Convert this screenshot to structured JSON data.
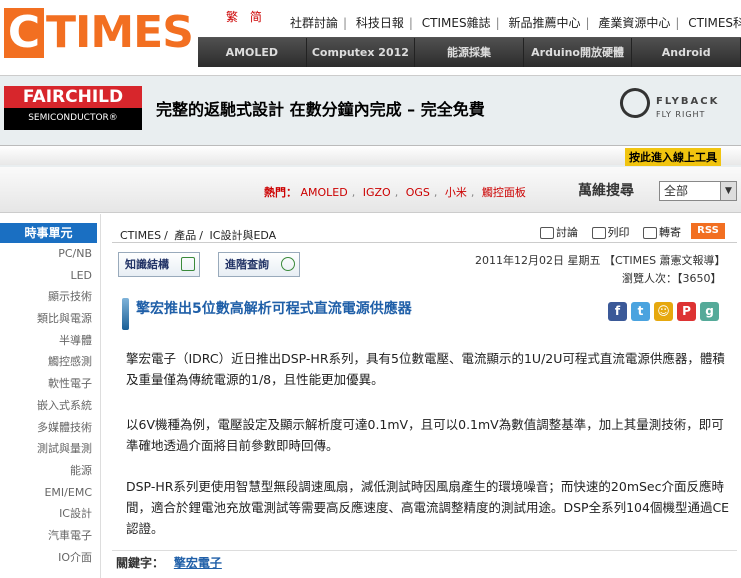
{
  "header": {
    "logo_c": "C",
    "logo_rest": "TIMES",
    "lang": [
      "繁",
      "简"
    ],
    "toplinks": [
      "社群討論",
      "科技日報",
      "CTIMES雜誌",
      "新品推薦中心",
      "產業資源中心",
      "CTIMES科技"
    ],
    "nav": [
      "AMOLED",
      "Computex 2012",
      "能源採集",
      "Arduino開放硬體",
      "Android"
    ]
  },
  "banner": {
    "fc_top": "FAIRCHILD",
    "fc_bottom": "SEMICONDUCTOR®",
    "text": "完整的返馳式設計 在數分鐘內完成 – 完全免費",
    "flyback_t1": "FLYBACK",
    "flyback_t2": "FLY RIGHT",
    "cta": "按此進入線上工具"
  },
  "hotbar": {
    "label": "熱門：",
    "items": [
      "AMOLED",
      "IGZO",
      "OGS",
      "小米",
      "觸控面板"
    ],
    "search_label": "萬維搜尋",
    "search_value": "全部"
  },
  "sidebar": {
    "title": "時事單元",
    "items": [
      "PC/NB",
      "LED",
      "顯示技術",
      "類比與電源",
      "半導體",
      "觸控感測",
      "軟性電子",
      "嵌入式系統",
      "多媒體技術",
      "測試與量測",
      "能源",
      "EMI/EMC",
      "IC設計",
      "汽車電子",
      "IO介面"
    ]
  },
  "main": {
    "breadcrumb": [
      "CTIMES",
      "產品",
      "IC設計與EDA"
    ],
    "tools": [
      "討論",
      "列印",
      "轉寄"
    ],
    "rss": "RSS",
    "btn_struct": "知識結構",
    "btn_query": "進階查詢",
    "date": "2011年12月02日 星期五 【CTIMES 蕭憲文報導】",
    "views": "瀏覽人次：【3650】",
    "title": "擎宏推出5位數高解析可程式直流電源供應器",
    "para1": "擎宏電子（IDRC）近日推出DSP-HR系列，具有5位數電壓、電流顯示的1U/2U可程式直流電源供應器，體積及重量僅為傳統電源的1/8，且性能更加優異。",
    "para2": "以6V機種為例，電壓設定及顯示解析度可達0.1mV，且可以0.1mV為數值調整基準，加上其量測技術，即可準確地透過介面將目前參數即時回傳。",
    "para3": "DSP-HR系列更使用智慧型無段調速風扇，減低測試時因風扇產生的環境噪音；而快速的20mSec介面反應時間，適合於鋰電池充放電測試等需要高反應速度、高電流調整精度的測試用途。DSP全系列104個機型通過CE認證。",
    "kw_label": "關鍵字：",
    "kw": "擎宏電子"
  },
  "colors": {
    "brand": "#f26f21",
    "nav_bg": "#3a3a3a",
    "link": "#1f5fa8",
    "sidebar_title": "#1a6fc2"
  }
}
